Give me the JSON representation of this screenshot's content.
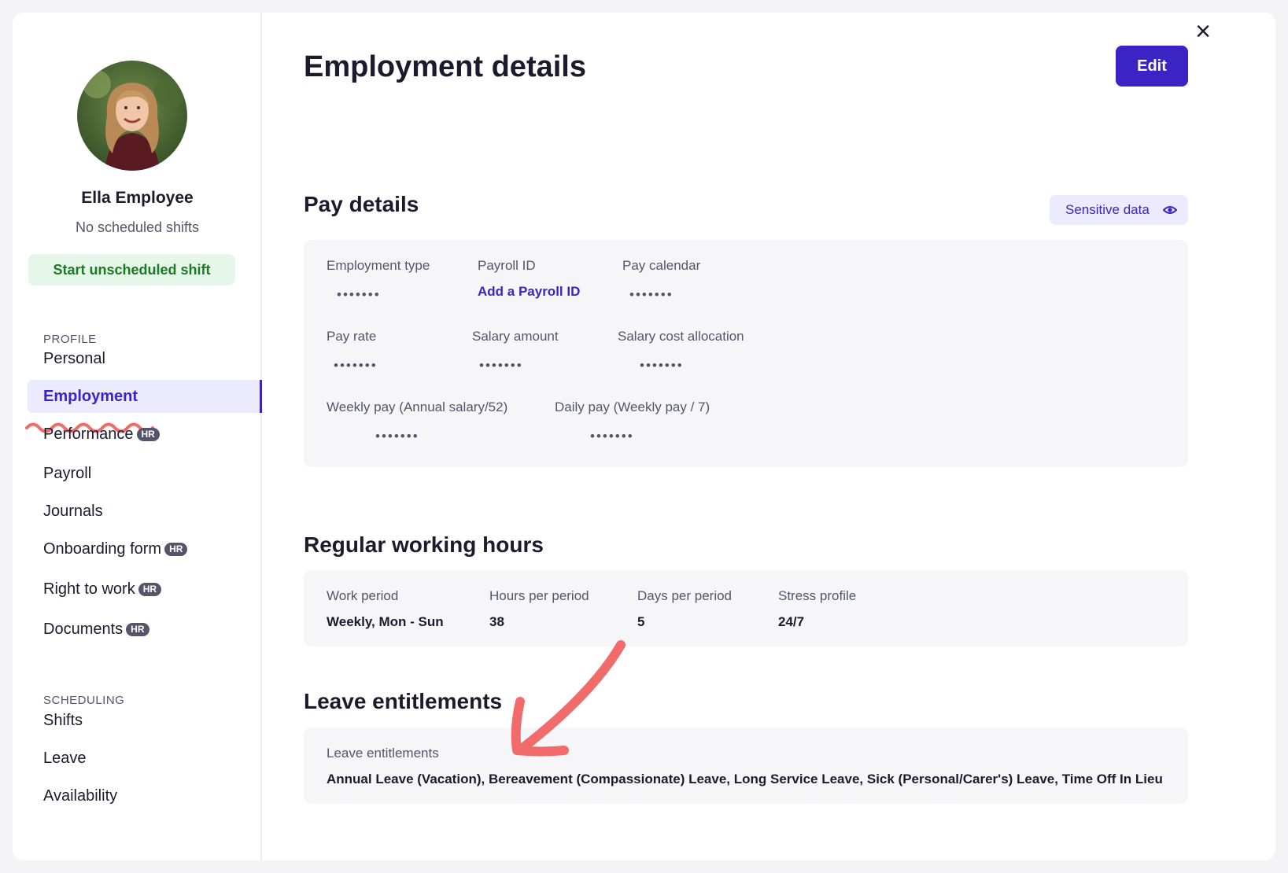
{
  "sidebar": {
    "employee_name": "Ella Employee",
    "shift_status": "No scheduled shifts",
    "start_shift_label": "Start unscheduled shift",
    "profile_section_label": "PROFILE",
    "profile_items": [
      {
        "label": "Personal",
        "hr": false
      },
      {
        "label": "Employment",
        "hr": false,
        "active": true
      },
      {
        "label": "Performance",
        "hr": true
      },
      {
        "label": "Payroll",
        "hr": false
      },
      {
        "label": "Journals",
        "hr": false
      },
      {
        "label": "Onboarding form",
        "hr": true
      },
      {
        "label": "Right to work",
        "hr": true
      },
      {
        "label": "Documents",
        "hr": true
      }
    ],
    "scheduling_section_label": "SCHEDULING",
    "scheduling_items": [
      {
        "label": "Shifts"
      },
      {
        "label": "Leave"
      },
      {
        "label": "Availability"
      }
    ],
    "hr_badge": "HR"
  },
  "header": {
    "title": "Employment details",
    "edit_label": "Edit",
    "close_icon": "×"
  },
  "pay_details": {
    "title": "Pay details",
    "sensitive_label": "Sensitive data",
    "mask": "•••••••",
    "employment_type_label": "Employment type",
    "payroll_id_label": "Payroll ID",
    "payroll_id_action": "Add a Payroll ID",
    "pay_calendar_label": "Pay calendar",
    "pay_rate_label": "Pay rate",
    "salary_amount_label": "Salary amount",
    "salary_cost_label": "Salary cost allocation",
    "weekly_pay_label": "Weekly pay (Annual salary/52)",
    "daily_pay_label": "Daily pay (Weekly pay / 7)"
  },
  "working_hours": {
    "title": "Regular working hours",
    "work_period_label": "Work period",
    "work_period_value": "Weekly, Mon - Sun",
    "hours_label": "Hours per period",
    "hours_value": "38",
    "days_label": "Days per period",
    "days_value": "5",
    "stress_label": "Stress profile",
    "stress_value": "24/7"
  },
  "leave": {
    "title": "Leave entitlements",
    "label": "Leave entitlements",
    "value": "Annual Leave (Vacation), Bereavement (Compassionate) Leave, Long Service Leave, Sick (Personal/Carer's) Leave, Time Off In Lieu"
  },
  "colors": {
    "accent": "#3a25c4",
    "annotation": "#f26b6b",
    "success_bg": "#e6f6e8",
    "success_text": "#1a7a24"
  }
}
